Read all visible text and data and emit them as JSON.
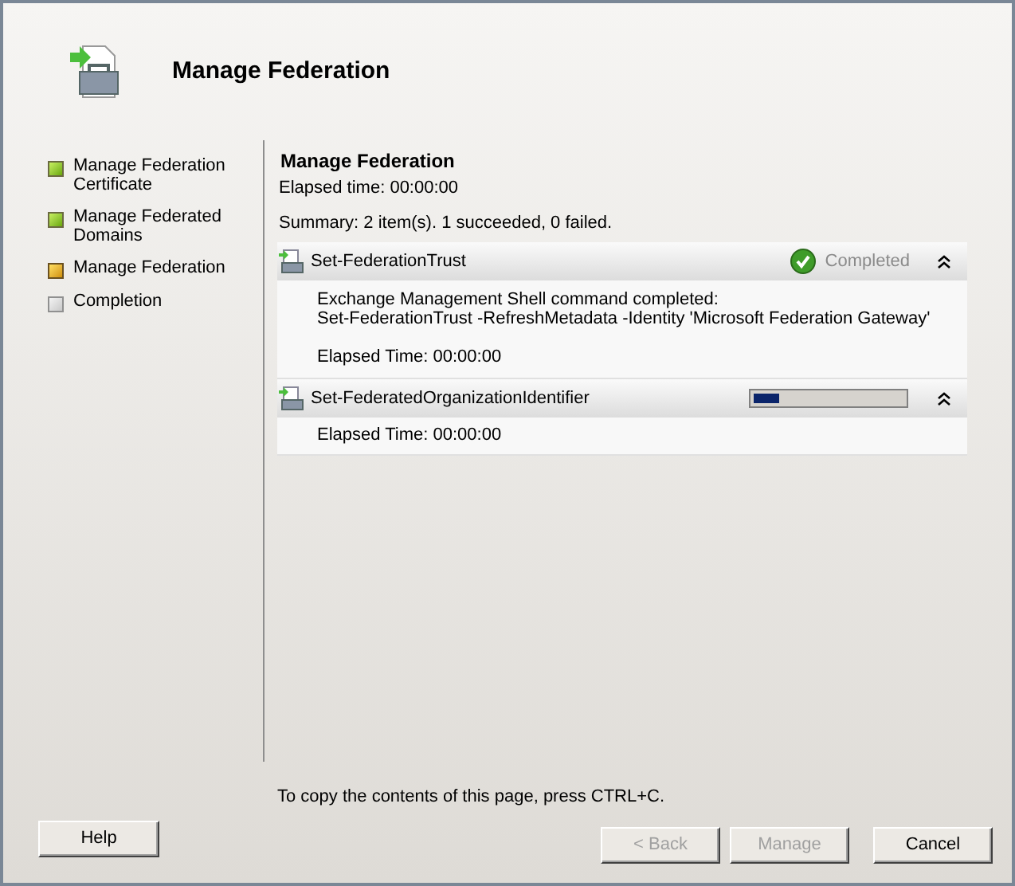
{
  "header": {
    "title": "Manage Federation"
  },
  "steps": [
    {
      "label": "Manage Federation Certificate",
      "done": true,
      "current": false
    },
    {
      "label": "Manage Federated Domains",
      "done": true,
      "current": false
    },
    {
      "label": "Manage Federation",
      "done": false,
      "current": true
    },
    {
      "label": "Completion",
      "done": false,
      "current": false
    }
  ],
  "content": {
    "heading": "Manage Federation",
    "elapsed": "Elapsed time: 00:00:00",
    "summary": "Summary: 2 item(s). 1 succeeded, 0 failed.",
    "tasks": [
      {
        "name": "Set-FederationTrust",
        "kind": "completed",
        "status_text": "Completed",
        "expanded": true,
        "output": [
          "Exchange Management Shell command completed:",
          "Set-FederationTrust -RefreshMetadata -Identity 'Microsoft Federation Gateway'"
        ],
        "elapsed": "Elapsed Time: 00:00:00"
      },
      {
        "name": "Set-FederatedOrganizationIdentifier",
        "kind": "progress",
        "level": 0.17,
        "expanded": true,
        "elapsed": "Elapsed Time: 00:00:00"
      }
    ]
  },
  "footer": {
    "hint": "To copy the contents of this page, press CTRL+C.",
    "buttons": [
      {
        "label": "Help",
        "disabled": false
      },
      {
        "label": "< Back",
        "disabled": true
      },
      {
        "label": "Manage",
        "disabled": true
      },
      {
        "label": "Cancel",
        "disabled": false
      }
    ]
  }
}
